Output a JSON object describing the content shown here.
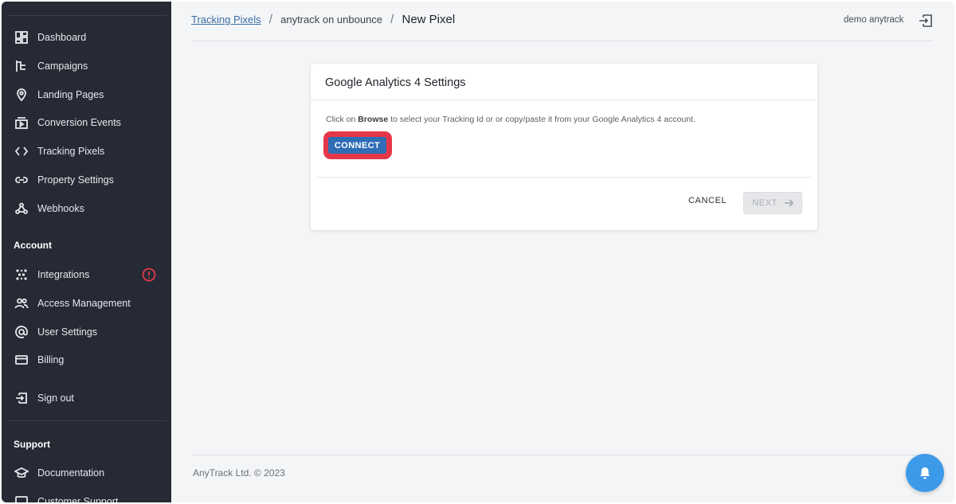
{
  "sidebar": {
    "main_items": [
      {
        "label": "Dashboard",
        "icon": "dashboard-icon"
      },
      {
        "label": "Campaigns",
        "icon": "campaigns-icon"
      },
      {
        "label": "Landing Pages",
        "icon": "location-pin-icon"
      },
      {
        "label": "Conversion Events",
        "icon": "conversion-icon"
      },
      {
        "label": "Tracking Pixels",
        "icon": "code-icon"
      },
      {
        "label": "Property Settings",
        "icon": "link-icon"
      },
      {
        "label": "Webhooks",
        "icon": "webhook-icon"
      }
    ],
    "account_heading": "Account",
    "account_items": [
      {
        "label": "Integrations",
        "icon": "integrations-icon",
        "alert": true
      },
      {
        "label": "Access Management",
        "icon": "users-icon"
      },
      {
        "label": "User Settings",
        "icon": "at-sign-icon"
      },
      {
        "label": "Billing",
        "icon": "credit-card-icon"
      }
    ],
    "sign_out": {
      "label": "Sign out",
      "icon": "sign-out-icon"
    },
    "support_heading": "Support",
    "support_items": [
      {
        "label": "Documentation",
        "icon": "graduation-cap-icon"
      },
      {
        "label": "Customer Support",
        "icon": "support-icon"
      }
    ]
  },
  "header": {
    "breadcrumb": {
      "link": "Tracking Pixels",
      "middle": "anytrack on unbounce",
      "current": "New Pixel",
      "separator": "/"
    },
    "user_name": "demo anytrack"
  },
  "card": {
    "title": "Google Analytics 4 Settings",
    "desc_prefix": "Click on ",
    "desc_bold": "Browse",
    "desc_suffix": " to select your Tracking Id or or copy/paste it from your Google Analytics 4 account.",
    "connect_label": "CONNECT",
    "cancel_label": "CANCEL",
    "next_label": "NEXT"
  },
  "footer": {
    "copyright": "AnyTrack Ltd. © 2023"
  },
  "colors": {
    "sidebar_bg": "#252a35",
    "primary": "#2f6eb5",
    "highlight": "#e5374a",
    "fab": "#3d9ae8"
  }
}
